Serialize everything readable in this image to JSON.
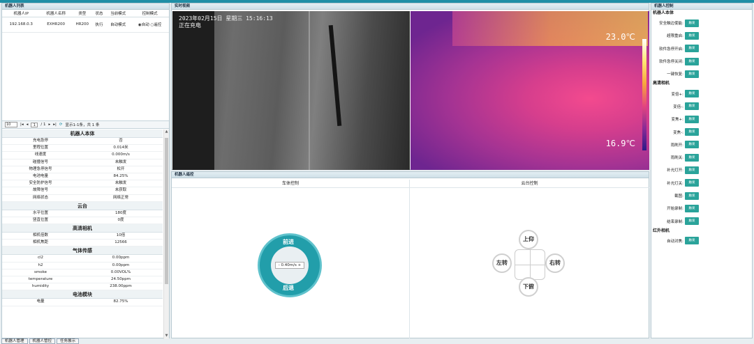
{
  "colors": {
    "accent": "#1f8fa6",
    "button": "#2aa39a"
  },
  "robot_list": {
    "title": "机器人列表",
    "columns": [
      "机器人IP",
      "机器人名称",
      "类型",
      "状态",
      "当前模式",
      "控制模式"
    ],
    "rows": [
      {
        "ip": "192.168.0.3",
        "name": "EXHR200",
        "type": "HR200",
        "status": "执行",
        "mode": "自动模式",
        "ctrl_auto": "自动",
        "ctrl_remote": "遥控"
      }
    ]
  },
  "pager": {
    "page_size": "10",
    "page": "1",
    "total_pages": "/ 1",
    "summary": "显示1-1条，共 1 条"
  },
  "robot_body": {
    "title": "机器人本体",
    "items": [
      {
        "k": "充电急停",
        "v": "否"
      },
      {
        "k": "里程位置",
        "v": "0.014米"
      },
      {
        "k": "线速度",
        "v": "0.000m/s"
      },
      {
        "k": "碰撞信号",
        "v": "未触发"
      },
      {
        "k": "物理急停信号",
        "v": "松开"
      },
      {
        "k": "电池电量",
        "v": "84.25%"
      },
      {
        "k": "安全防护信号",
        "v": "未触发"
      },
      {
        "k": "故障信号",
        "v": "未获取"
      },
      {
        "k": "网络状态",
        "v": "网络正常"
      }
    ]
  },
  "gimbal": {
    "title": "云台",
    "items": [
      {
        "k": "水平位置",
        "v": "180度"
      },
      {
        "k": "竖直位置",
        "v": "0度"
      }
    ]
  },
  "hd_camera": {
    "title": "高清相机",
    "items": [
      {
        "k": "相机倍数",
        "v": "10倍"
      },
      {
        "k": "相机焦距",
        "v": "12566"
      }
    ]
  },
  "gas_sensor": {
    "title": "气体传感",
    "items": [
      {
        "k": "cl2",
        "v": "0.00ppm"
      },
      {
        "k": "h2",
        "v": "0.00ppm"
      },
      {
        "k": "smoke",
        "v": "0.00VOL%"
      },
      {
        "k": "temperature",
        "v": "24.50ppm"
      },
      {
        "k": "humidity",
        "v": "238.00ppm"
      }
    ]
  },
  "battery": {
    "title": "电池模块",
    "items": [
      {
        "k": "电量",
        "v": "82.75%"
      }
    ]
  },
  "tabs": [
    "机器人管理",
    "机器人管控",
    "任务展示"
  ],
  "video": {
    "title": "实时视频",
    "timestamp": "2023年02月15日 星期三 15:16:13",
    "status": "正在充电",
    "ir_max": "23.0℃",
    "ir_min": "16.9℃"
  },
  "control": {
    "title": "机器人遥控",
    "car_title": "车体控制",
    "ptz_title": "云台控制",
    "forward": "前进",
    "backward": "后退",
    "speed": "0.40m/s",
    "minus": "-",
    "plus": "+",
    "up": "上仰",
    "down": "下俯",
    "left": "左转",
    "right": "右转"
  },
  "right_panel": {
    "title": "机器人控制",
    "btn": "触发",
    "sec_body": "机器人本体",
    "body_items": [
      "安全触边使能:",
      "超限重启:",
      "软件急停开启:",
      "软件急停关闭:",
      "一键恢复:"
    ],
    "sec_hd": "高清相机",
    "hd_items": [
      "变倍+:",
      "变倍-:",
      "变焦+:",
      "变焦-:",
      "雨刷开:",
      "雨刷关:",
      "补光灯开:",
      "补光灯关:",
      "截图:",
      "开始录制:",
      "结束录制:"
    ],
    "sec_ir": "红外相机",
    "ir_items": [
      "自动对焦:"
    ]
  }
}
